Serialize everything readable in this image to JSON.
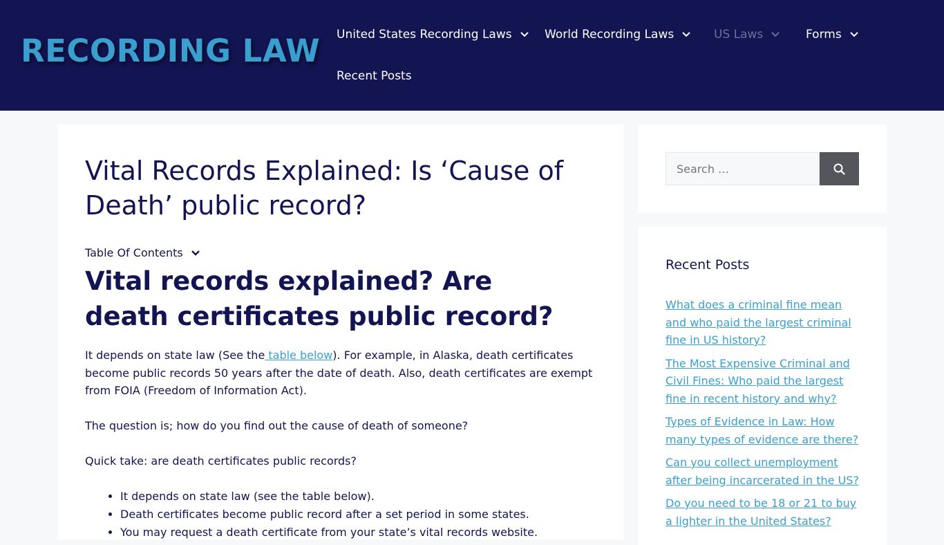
{
  "site": {
    "logo_text": "RECORDING LAW"
  },
  "nav": {
    "items": [
      {
        "label": "United States Recording Laws"
      },
      {
        "label": "World Recording Laws"
      },
      {
        "label": "US Laws"
      },
      {
        "label": "Forms"
      },
      {
        "label": "Recent Posts"
      }
    ]
  },
  "article": {
    "title": "Vital Records Explained: Is ‘Cause of Death’ public record?",
    "toc_label": "Table Of Contents",
    "heading": "Vital records explained? Are death certificates public record?",
    "p1_before_link": "It depends on state law (See the",
    "p1_link": " table below",
    "p1_after_link": "). For example, in Alaska, death certificates become public records 50 years after the date of death. Also, death certificates are exempt from FOIA (Freedom of Information Act).",
    "p2": " The question is; how do you find out the cause of death of someone?",
    "p3": "Quick take: are death certificates public records?",
    "bullets": [
      "It depends on state law (see the table below).",
      "Death certificates become public record after a set period in some states.",
      "You may request a death certificate from your state’s vital records website."
    ]
  },
  "sidebar": {
    "search_placeholder": "Search …",
    "recent_title": "Recent Posts",
    "recent_posts": [
      "What does a criminal fine mean and who paid the largest criminal fine in US history?",
      "The Most Expensive Criminal and Civil Fines: Who paid the largest fine in recent history and why?",
      "Types of Evidence in Law: How many types of evidence are there?",
      "Can you collect unemployment after being incarcerated in the US?",
      "Do you need to be 18 or 21 to buy a lighter in the United States?"
    ]
  },
  "colors": {
    "header_bg": "#131452",
    "accent": "#3a9fcf",
    "text": "#131452",
    "search_button": "#55555e"
  }
}
